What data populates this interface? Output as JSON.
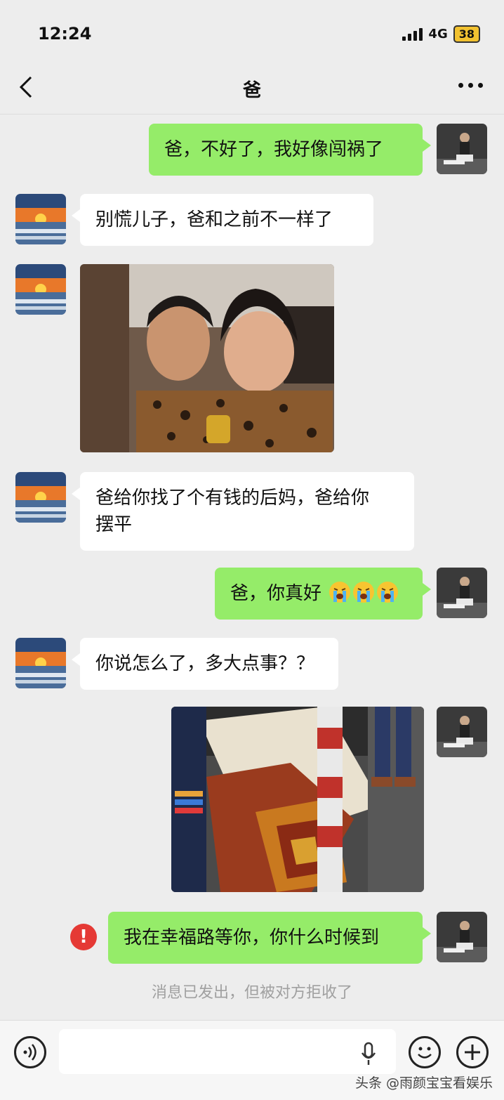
{
  "status_bar": {
    "time": "12:24",
    "network": "4G",
    "battery": "38"
  },
  "header": {
    "title": "爸"
  },
  "messages": [
    {
      "sender": "me",
      "text": "爸，不好了，我好像闯祸了"
    },
    {
      "sender": "dad",
      "text": "别慌儿子，爸和之前不一样了"
    },
    {
      "sender": "dad",
      "type": "image",
      "depicts": "photo-man-and-older-woman-in-car"
    },
    {
      "sender": "dad",
      "line1": "爸给你找了个有钱的后妈，爸给你",
      "line2": "摆平"
    },
    {
      "sender": "me",
      "text": "爸，你真好",
      "emoji": "crying-face x3"
    },
    {
      "sender": "dad",
      "text": "你说怎么了，多大点事？？"
    },
    {
      "sender": "me",
      "type": "image",
      "depicts": "photo-ornate-coffin-by-pole"
    },
    {
      "sender": "me",
      "text": "我在幸福路等你，你什么时候到",
      "failed": true
    }
  ],
  "error_mark": "!",
  "system_note": "消息已发出，但被对方拒收了",
  "watermark": "头条 @雨颜宝宝看娱乐",
  "colors": {
    "my_bubble": "#95ec69",
    "other_bubble": "#ffffff",
    "background": "#ededed",
    "error": "#e53935"
  }
}
